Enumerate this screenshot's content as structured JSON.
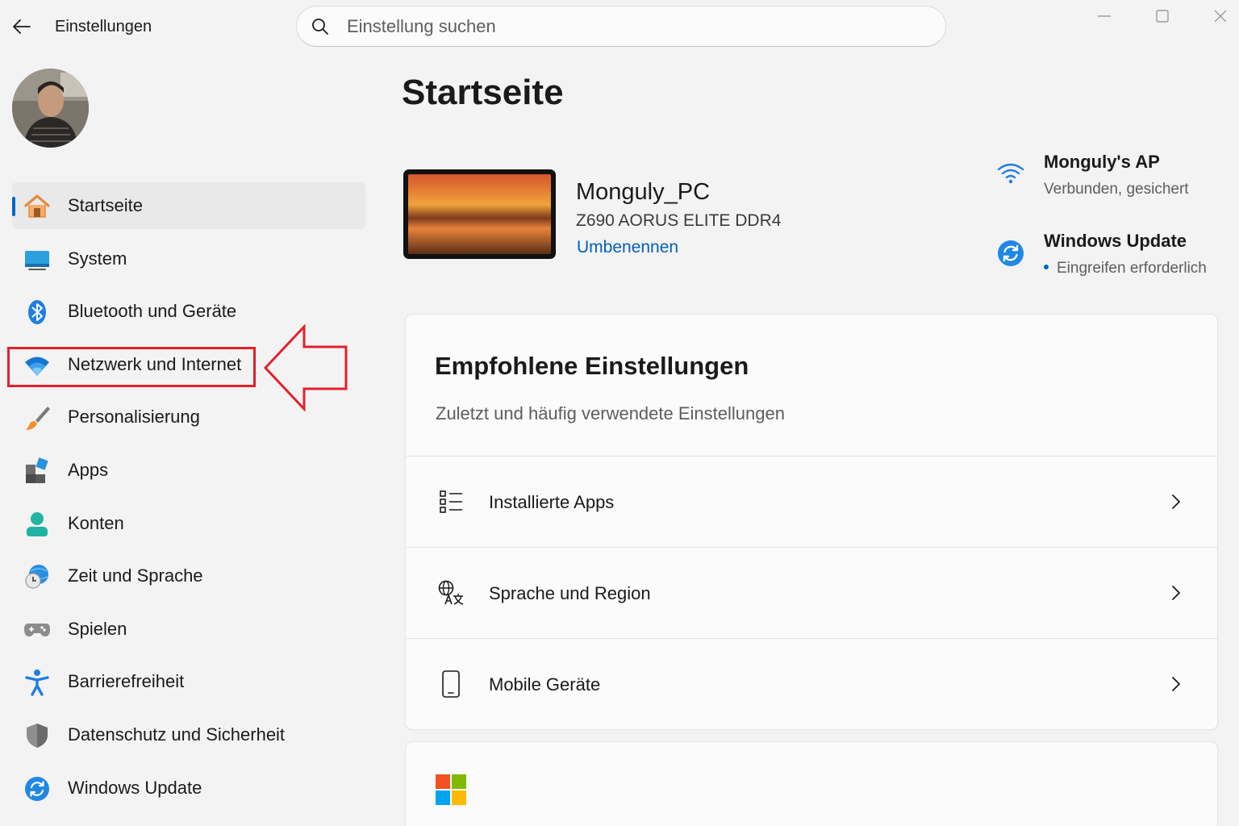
{
  "window": {
    "title": "Einstellungen"
  },
  "search": {
    "placeholder": "Einstellung suchen"
  },
  "sidebar": {
    "items": [
      {
        "label": "Startseite",
        "icon": "home-icon",
        "active": true
      },
      {
        "label": "System",
        "icon": "system-monitor-icon"
      },
      {
        "label": "Bluetooth und Geräte",
        "icon": "bluetooth-icon"
      },
      {
        "label": "Netzwerk und Internet",
        "icon": "wifi-icon"
      },
      {
        "label": "Personalisierung",
        "icon": "brush-icon"
      },
      {
        "label": "Apps",
        "icon": "apps-icon"
      },
      {
        "label": "Konten",
        "icon": "account-icon"
      },
      {
        "label": "Zeit und Sprache",
        "icon": "globe-clock-icon"
      },
      {
        "label": "Spielen",
        "icon": "gamepad-icon"
      },
      {
        "label": "Barrierefreiheit",
        "icon": "accessibility-icon"
      },
      {
        "label": "Datenschutz und Sicherheit",
        "icon": "shield-icon"
      },
      {
        "label": "Windows Update",
        "icon": "update-icon"
      }
    ]
  },
  "main": {
    "title": "Startseite",
    "device": {
      "name": "Monguly_PC",
      "model": "Z690 AORUS ELITE DDR4",
      "rename_label": "Umbenennen"
    },
    "network": {
      "title": "Monguly's AP",
      "status": "Verbunden, gesichert"
    },
    "update": {
      "title": "Windows Update",
      "status": "Eingreifen erforderlich"
    },
    "recommended": {
      "title": "Empfohlene Einstellungen",
      "subtitle": "Zuletzt und häufig verwendete Einstellungen",
      "rows": [
        {
          "label": "Installierte Apps",
          "icon": "list-icon"
        },
        {
          "label": "Sprache und Region",
          "icon": "language-icon"
        },
        {
          "label": "Mobile Geräte",
          "icon": "phone-icon"
        }
      ]
    }
  },
  "colors": {
    "accent": "#0067c0",
    "link": "#005fb8",
    "annotation": "#e3202c"
  }
}
